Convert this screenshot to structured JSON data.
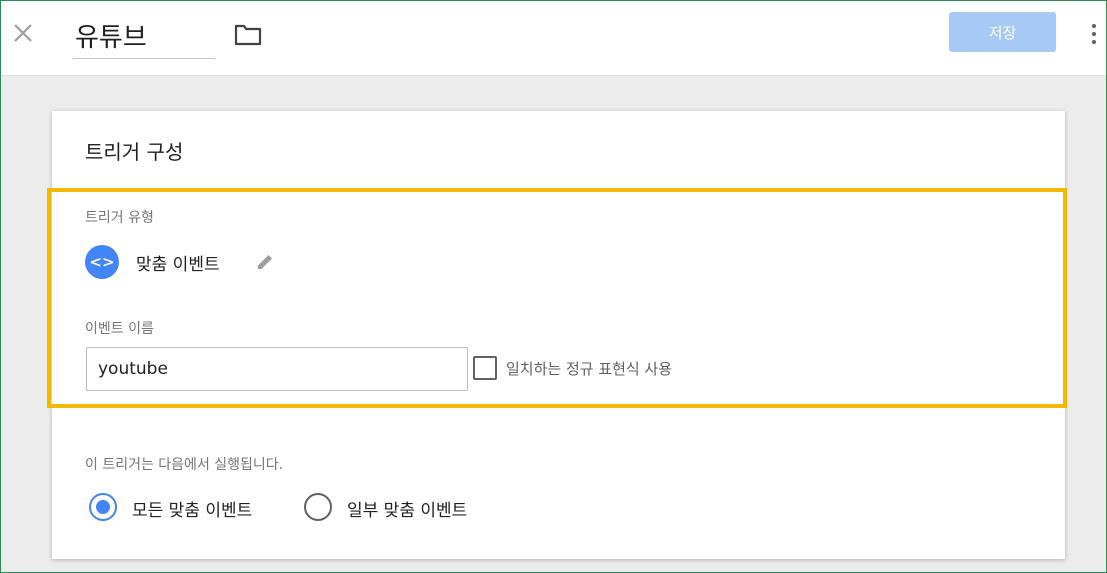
{
  "header": {
    "title": "유튜브",
    "save_label": "저장",
    "save_color": "#a7c9f6",
    "icons": [
      "close-icon",
      "folder-icon",
      "more-vert-icon"
    ]
  },
  "trigger": {
    "section_title": "트리거 구성",
    "type_label": "트리거 유형",
    "type_name": "맞춤 이벤트",
    "type_icon": "<>",
    "type_icon_color": "#4285f4",
    "event_name_label": "이벤트 이름",
    "event_name_value": "youtube",
    "regex_label": "일치하는 정규 표현식 사용",
    "regex_checked": false,
    "fires_on_label": "이 트리거는 다음에서 실행됩니다.",
    "options": [
      {
        "label": "모든 맞춤 이벤트",
        "selected": true
      },
      {
        "label": "일부 맞춤 이벤트",
        "selected": false
      }
    ],
    "highlight_color": "#f5b800"
  }
}
